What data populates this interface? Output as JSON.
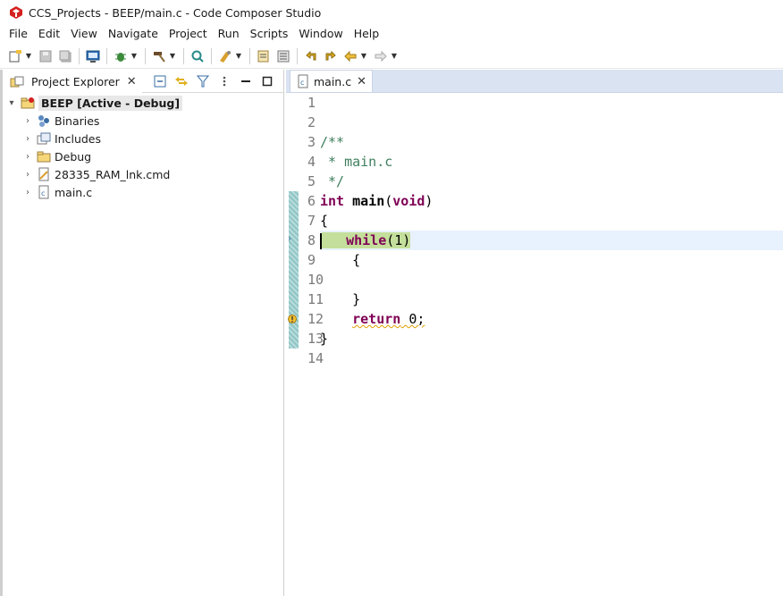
{
  "window": {
    "title": "CCS_Projects - BEEP/main.c - Code Composer Studio"
  },
  "menu": [
    "File",
    "Edit",
    "View",
    "Navigate",
    "Project",
    "Run",
    "Scripts",
    "Window",
    "Help"
  ],
  "explorer": {
    "tab_label": "Project Explorer",
    "root": {
      "label": "BEEP  [Active - Debug]"
    },
    "items": [
      {
        "label": "Binaries",
        "icon": "binaries-icon"
      },
      {
        "label": "Includes",
        "icon": "includes-icon"
      },
      {
        "label": "Debug",
        "icon": "folder-icon"
      },
      {
        "label": "28335_RAM_lnk.cmd",
        "icon": "cmd-file-icon"
      },
      {
        "label": "main.c",
        "icon": "c-file-icon"
      }
    ]
  },
  "editor": {
    "tab_label": "main.c",
    "line_numbers": [
      "1",
      "2",
      "3",
      "4",
      "5",
      "6",
      "7",
      "8",
      "9",
      "10",
      "11",
      "12",
      "13",
      "14"
    ],
    "code": {
      "l3": "/**",
      "l4": " * main.c",
      "l5": " */",
      "l6_kw": "int",
      "l6_fn": "main",
      "l6_open": "(",
      "l6_kw2": "void",
      "l6_close": ")",
      "l7": "{",
      "l8_kw": "while",
      "l8_rest": "(1)",
      "l9": "    {",
      "l11": "    }",
      "l12_kw": "return",
      "l12_rest": " 0;",
      "l13": "}"
    }
  },
  "colors": {
    "comment": "#3f7f5f",
    "keyword": "#7f0055",
    "current_line": "#e8f2fe",
    "tab_bar": "#d9e3f2"
  }
}
